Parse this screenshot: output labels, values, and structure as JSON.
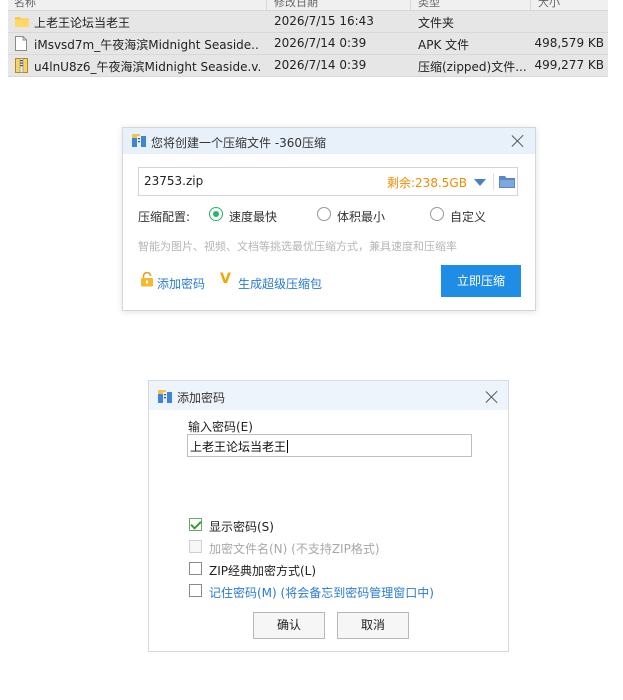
{
  "file_list": {
    "columns": [
      "名称",
      "修改日期",
      "类型",
      "大小"
    ],
    "rows": [
      {
        "name": "上老王论坛当老王",
        "date": "2026/7/15 16:43",
        "type": "文件夹",
        "size": "",
        "icon": "folder-icon"
      },
      {
        "name": "iMsvsd7m_午夜海滨Midnight Seaside....",
        "date": "2026/7/14 0:39",
        "type": "APK 文件",
        "size": "498,579 KB",
        "icon": "file-icon"
      },
      {
        "name": "u4lnU8z6_午夜海滨Midnight Seaside.v...",
        "date": "2026/7/14 0:39",
        "type": "压缩(zipped)文件...",
        "size": "499,277 KB",
        "icon": "zip-file-icon"
      }
    ]
  },
  "compress_dialog": {
    "title": "您将创建一个压缩文件 -360压缩",
    "filename": "23753.zip",
    "remaining_space": "剩余:238.5GB",
    "config_label": "压缩配置:",
    "options": [
      {
        "label": "速度最快",
        "selected": true
      },
      {
        "label": "体积最小",
        "selected": false
      },
      {
        "label": "自定义",
        "selected": false
      }
    ],
    "hint": "智能为图片、视频、文档等挑选最优压缩方式，兼具速度和压缩率",
    "add_password_link": "添加密码",
    "super_package_link": "生成超级压缩包",
    "compress_button": "立即压缩"
  },
  "password_dialog": {
    "title": "添加密码",
    "input_label": "输入密码(E)",
    "password_value": "上老王论坛当老王",
    "checkboxes": [
      {
        "label": "显示密码(S)",
        "checked": true,
        "disabled": false,
        "style": "normal"
      },
      {
        "label": "加密文件名(N) (不支持ZIP格式)",
        "checked": false,
        "disabled": true,
        "style": "dim"
      },
      {
        "label": "ZIP经典加密方式(L)",
        "checked": false,
        "disabled": false,
        "style": "normal"
      },
      {
        "label": "记住密码(M) (将会备忘到密码管理窗口中)",
        "checked": false,
        "disabled": false,
        "style": "blue"
      }
    ],
    "ok_button": "确认",
    "cancel_button": "取消"
  },
  "colors": {
    "accent_blue": "#1f8ce6",
    "link_blue": "#2a7bd2",
    "space_orange": "#f08c00",
    "radio_green": "#2bb36a"
  }
}
